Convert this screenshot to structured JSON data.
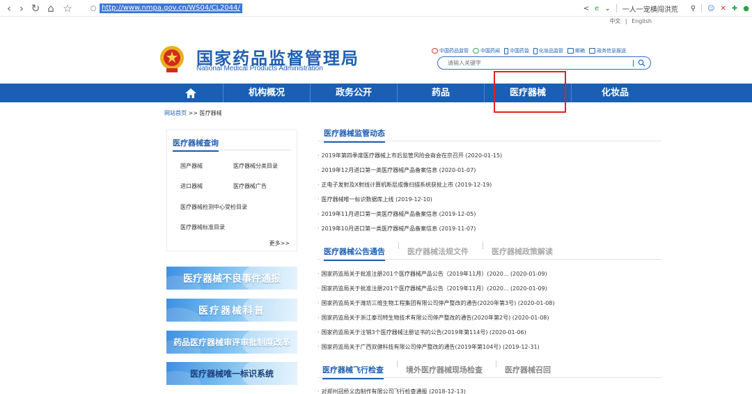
{
  "browser": {
    "url": "http://www.nmpa.gov.cn/WS04/CL2044/",
    "right_text": "一人一宠横闯洪荒",
    "back_glyph": "‹",
    "forward_glyph": "›",
    "refresh_glyph": "↻",
    "home_glyph": "⌂",
    "star_glyph": "☆"
  },
  "top_links": {
    "chinese": "中文",
    "sep": "|",
    "english": "English"
  },
  "header": {
    "title_cn": "国家药品监督管理局",
    "title_en": "National Medical Products Administration",
    "quick_links": [
      "中国药品监管",
      "中国药闻",
      "中国药监",
      "化妆品监管",
      "邮箱",
      "政务信息报送"
    ],
    "search_placeholder": "请输入关键字"
  },
  "nav": {
    "items": [
      "机构概况",
      "政务公开",
      "药品",
      "医疗器械",
      "化妆品"
    ],
    "highlighted": "医疗器械"
  },
  "breadcrumb": {
    "home": "网站首页",
    "sep": " >> ",
    "current": "医疗器械"
  },
  "sidebar": {
    "query_title": "医疗器械查询",
    "links": [
      "国产器械",
      "医疗器械分类目录",
      "进口器械",
      "医疗器械广告",
      "医疗器械检测中心受检目录",
      "医疗器械标准目录"
    ],
    "more": "更多>>",
    "banners": [
      "医疗器械不良事件通报",
      "医疗器械科普",
      "药品医疗器械审评审批制度改革",
      "医疗器械唯一标识系统"
    ]
  },
  "main": {
    "dynamics_title": "医疗器械监管动态",
    "dynamics": [
      "2019年第四季度医疗器械上市后监管风险会商会在京召开 (2020-01-15)",
      "2019年12月进口第一类医疗器械产品备案信息 (2020-01-07)",
      "正电子发射及X射线计算机断层成像扫描系统获批上市 (2019-12-19)",
      "医疗器械唯一标识数据库上线 (2019-12-10)",
      "2019年11月进口第一类医疗器械产品备案信息 (2019-12-05)",
      "2019年10月进口第一类医疗器械产品备案信息 (2019-11-07)"
    ],
    "notice_tabs": [
      "医疗器械公告通告",
      "医疗器械法规文件",
      "医疗器械政策解读"
    ],
    "notices": [
      "国家药监局关于批准注册201个医疗器械产品公告（2019年11月）(2020... (2020-01-09)",
      "国家药监局关于批准注册201个医疗器械产品公告（2019年11月）(2020... (2020-01-09)",
      "国家药监局关于潍坊三维生物工程集团有限公司停产整改的通告(2020年第3号) (2020-01-08)",
      "国家药监局关于浙江泰司特生物技术有限公司停产整改的通告(2020年第2号) (2020-01-08)",
      "国家药监局关于注销3个医疗器械注册证书的公告(2019年第114号) (2020-01-06)",
      "国家药监局关于广西双健科技有限公司停产整改的通告(2019年第104号) (2019-12-31)"
    ],
    "inspection_tabs": [
      "医疗器械飞行检查",
      "境外医疗器械现场检查",
      "医疗器械召回"
    ],
    "inspections": [
      "对郑州冠桥义齿制作有限公司飞行检查通报 (2018-12-13)"
    ]
  },
  "colors": {
    "brand_blue": "#1a5fb4",
    "highlight_red": "#e02020"
  }
}
